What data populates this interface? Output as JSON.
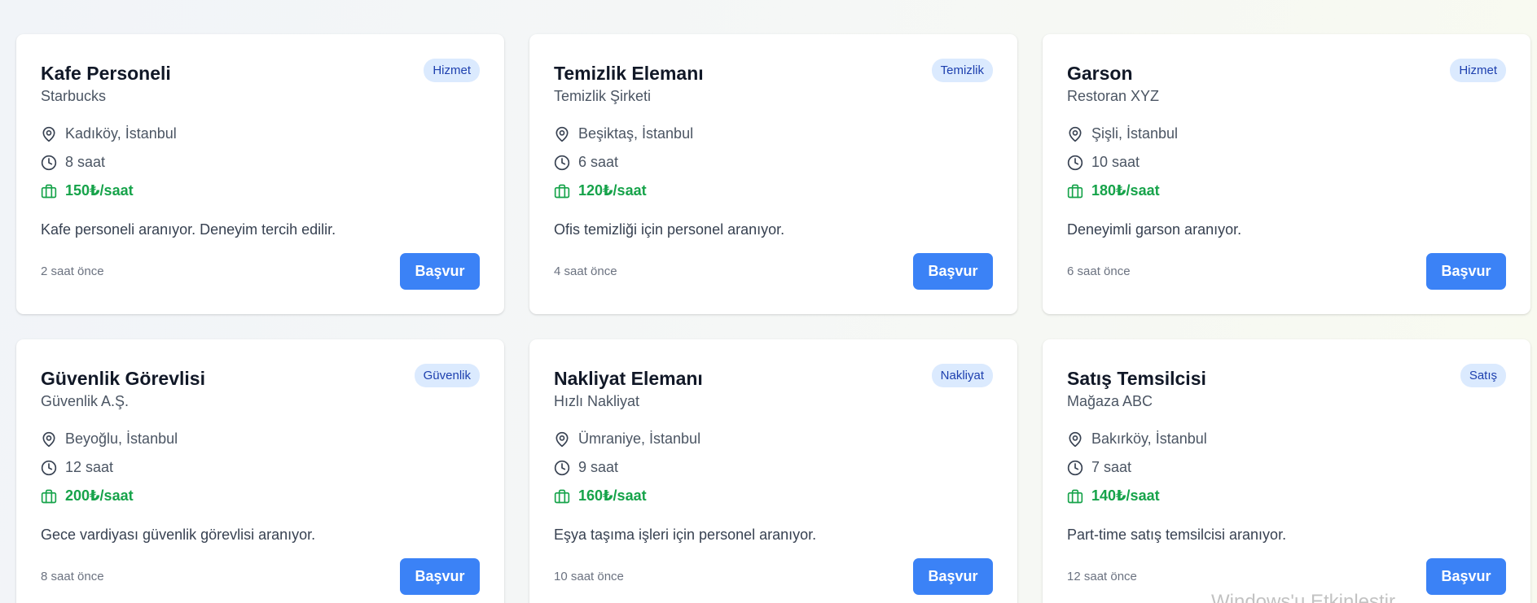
{
  "colors": {
    "accent": "#3b82f6",
    "wage_green": "#16a34a",
    "badge_bg": "#dbeafe",
    "badge_text": "#1e40af"
  },
  "icons": {
    "location": "map-pin-icon",
    "hours": "clock-icon",
    "wage": "briefcase-icon"
  },
  "jobs": [
    {
      "title": "Kafe Personeli",
      "company": "Starbucks",
      "category": "Hizmet",
      "location": "Kadıköy, İstanbul",
      "hours": "8 saat",
      "wage": "150₺/saat",
      "description": "Kafe personeli aranıyor. Deneyim tercih edilir.",
      "posted": "2 saat önce",
      "apply_label": "Başvur"
    },
    {
      "title": "Temizlik Elemanı",
      "company": "Temizlik Şirketi",
      "category": "Temizlik",
      "location": "Beşiktaş, İstanbul",
      "hours": "6 saat",
      "wage": "120₺/saat",
      "description": "Ofis temizliği için personel aranıyor.",
      "posted": "4 saat önce",
      "apply_label": "Başvur"
    },
    {
      "title": "Garson",
      "company": "Restoran XYZ",
      "category": "Hizmet",
      "location": "Şişli, İstanbul",
      "hours": "10 saat",
      "wage": "180₺/saat",
      "description": "Deneyimli garson aranıyor.",
      "posted": "6 saat önce",
      "apply_label": "Başvur"
    },
    {
      "title": "Güvenlik Görevlisi",
      "company": "Güvenlik A.Ş.",
      "category": "Güvenlik",
      "location": "Beyoğlu, İstanbul",
      "hours": "12 saat",
      "wage": "200₺/saat",
      "description": "Gece vardiyası güvenlik görevlisi aranıyor.",
      "posted": "8 saat önce",
      "apply_label": "Başvur"
    },
    {
      "title": "Nakliyat Elemanı",
      "company": "Hızlı Nakliyat",
      "category": "Nakliyat",
      "location": "Ümraniye, İstanbul",
      "hours": "9 saat",
      "wage": "160₺/saat",
      "description": "Eşya taşıma işleri için personel aranıyor.",
      "posted": "10 saat önce",
      "apply_label": "Başvur"
    },
    {
      "title": "Satış Temsilcisi",
      "company": "Mağaza ABC",
      "category": "Satış",
      "location": "Bakırköy, İstanbul",
      "hours": "7 saat",
      "wage": "140₺/saat",
      "description": "Part-time satış temsilcisi aranıyor.",
      "posted": "12 saat önce",
      "apply_label": "Başvur"
    }
  ],
  "os_watermark": "Windows'u Etkinleştir"
}
